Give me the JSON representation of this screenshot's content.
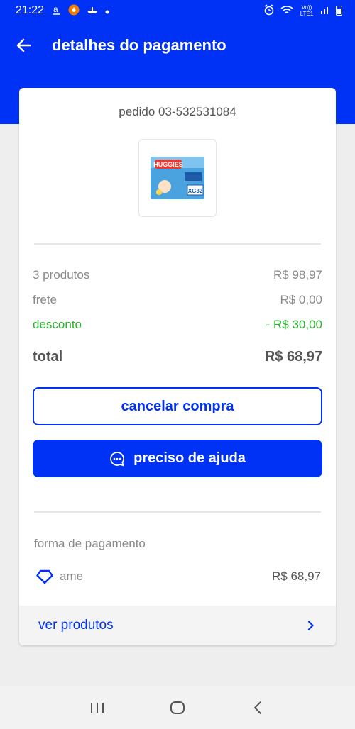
{
  "status_bar": {
    "time": "21:22",
    "network_label": "Vo)) LTE1"
  },
  "header": {
    "title": "detalhes do pagamento"
  },
  "order": {
    "id_text": "pedido 03-532531084",
    "product_brand": "HUGGIES",
    "product_size": "XG32"
  },
  "summary": {
    "items_label": "3 produtos",
    "items_value": "R$ 98,97",
    "shipping_label": "frete",
    "shipping_value": "R$ 0,00",
    "discount_label": "desconto",
    "discount_value": "- R$ 30,00",
    "total_label": "total",
    "total_value": "R$ 68,97"
  },
  "actions": {
    "cancel_label": "cancelar compra",
    "help_label": "preciso de ajuda"
  },
  "payment": {
    "section_label": "forma de pagamento",
    "method_name": "ame",
    "method_value": "R$ 68,97"
  },
  "footer_link": {
    "label": "ver produtos"
  },
  "colors": {
    "primary": "#0032f5",
    "discount": "#2bb32b",
    "muted_text": "#8a8a8a"
  },
  "icons": [
    "arrow-left-icon",
    "ame-heart-icon",
    "chat-bubble-icon",
    "chevron-right-icon"
  ]
}
